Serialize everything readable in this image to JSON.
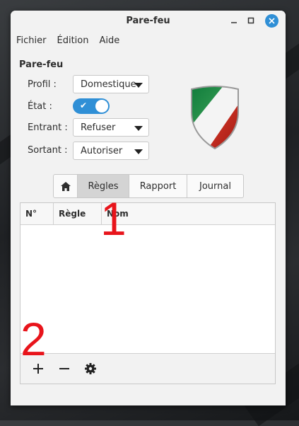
{
  "window": {
    "title": "Pare-feu"
  },
  "menu": [
    "Fichier",
    "Édition",
    "Aide"
  ],
  "section_title": "Pare-feu",
  "settings": {
    "profil_label": "Profil :",
    "profil_value": "Domestique",
    "etat_label": "État :",
    "etat_enabled": true,
    "entrant_label": "Entrant :",
    "entrant_value": "Refuser",
    "sortant_label": "Sortant :",
    "sortant_value": "Autoriser"
  },
  "tabs": {
    "home_icon": "home-icon",
    "items": [
      "Règles",
      "Rapport",
      "Journal"
    ],
    "active": "Règles"
  },
  "table": {
    "columns": [
      "N°",
      "Règle",
      "Nom"
    ],
    "rows": []
  },
  "toolbar": {
    "icons": [
      "plus-icon",
      "minus-icon",
      "gear-icon"
    ]
  },
  "annotations": [
    "1",
    "2"
  ],
  "colors": {
    "accent": "#2f8fd6",
    "close_button": "#2f8fd6",
    "annotation": "#e8141b"
  }
}
